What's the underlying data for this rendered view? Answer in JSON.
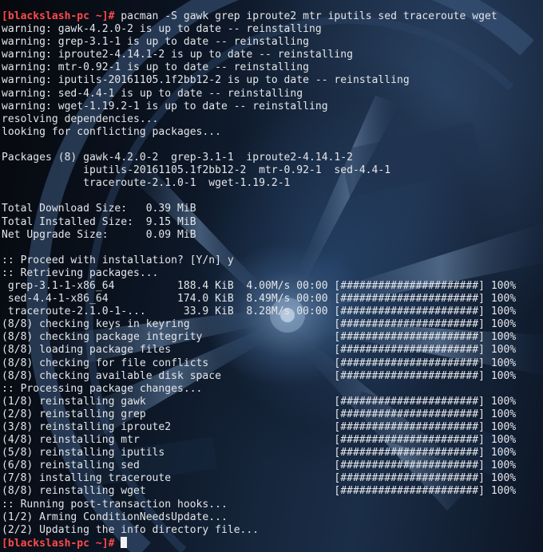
{
  "terminal": {
    "prompt_host": "[blackslash-pc ~]#",
    "lines": [
      " pacman -S gawk grep iproute2 mtr iputils sed traceroute wget",
      "warning: gawk-4.2.0-2 is up to date -- reinstalling",
      "warning: grep-3.1-1 is up to date -- reinstalling",
      "warning: iproute2-4.14.1-2 is up to date -- reinstalling",
      "warning: mtr-0.92-1 is up to date -- reinstalling",
      "warning: iputils-20161105.1f2bb12-2 is up to date -- reinstalling",
      "warning: sed-4.4-1 is up to date -- reinstalling",
      "warning: wget-1.19.2-1 is up to date -- reinstalling",
      "resolving dependencies...",
      "looking for conflicting packages...",
      "",
      "Packages (8) gawk-4.2.0-2  grep-3.1-1  iproute2-4.14.1-2",
      "             iputils-20161105.1f2bb12-2  mtr-0.92-1  sed-4.4-1",
      "             traceroute-2.1.0-1  wget-1.19.2-1",
      "",
      "Total Download Size:   0.39 MiB",
      "Total Installed Size:  9.15 MiB",
      "Net Upgrade Size:      0.09 MiB",
      "",
      ":: Proceed with installation? [Y/n] y",
      ":: Retrieving packages...",
      " grep-3.1-1-x86_64          188.4 KiB  4.00M/s 00:00 [######################] 100%",
      " sed-4.4-1-x86_64           174.0 KiB  8.49M/s 00:00 [######################] 100%",
      " traceroute-2.1.0-1-...      33.9 KiB  8.28M/s 00:00 [######################] 100%",
      "(8/8) checking keys in keyring                       [######################] 100%",
      "(8/8) checking package integrity                     [######################] 100%",
      "(8/8) loading package files                          [######################] 100%",
      "(8/8) checking for file conflicts                    [######################] 100%",
      "(8/8) checking available disk space                  [######################] 100%",
      ":: Processing package changes...",
      "(1/8) reinstalling gawk                              [######################] 100%",
      "(2/8) reinstalling grep                              [######################] 100%",
      "(3/8) reinstalling iproute2                          [######################] 100%",
      "(4/8) reinstalling mtr                               [######################] 100%",
      "(5/8) reinstalling iputils                           [######################] 100%",
      "(6/8) reinstalling sed                               [######################] 100%",
      "(7/8) installing traceroute                          [######################] 100%",
      "(8/8) reinstalling wget                              [######################] 100%",
      ":: Running post-transaction hooks...",
      "(1/2) Arming ConditionNeedsUpdate...",
      "(2/2) Updating the info directory file..."
    ]
  },
  "colors": {
    "prompt_host": "#ff4a4a",
    "text": "#e4e6ea",
    "cursor": "#f2f2f2",
    "background": "#0b1422"
  }
}
